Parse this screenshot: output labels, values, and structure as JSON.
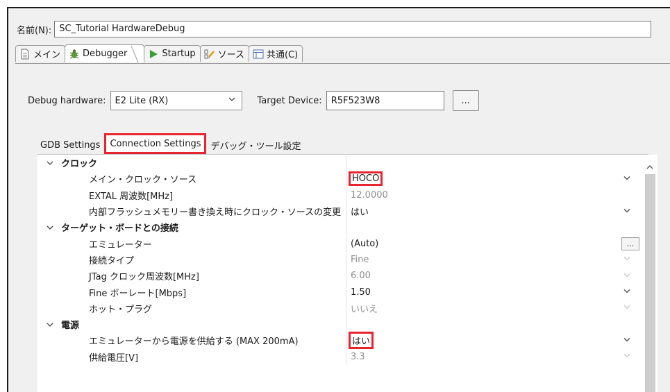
{
  "name_row": {
    "label": "名前(N):",
    "value": "SC_Tutorial HardwareDebug"
  },
  "main_tabs": [
    {
      "label": "メイン",
      "icon": "document-icon"
    },
    {
      "label": "Debugger",
      "icon": "bug-icon"
    },
    {
      "label": "Startup",
      "icon": "play-icon"
    },
    {
      "label": "ソース",
      "icon": "source-icon"
    },
    {
      "label": "共通(C)",
      "icon": "table-icon"
    }
  ],
  "debugger": {
    "hw_label": "Debug hardware:",
    "hw_value": "E2 Lite (RX)",
    "target_label": "Target Device:",
    "target_value": "R5F523W8",
    "browse_label": "..."
  },
  "sub_tabs": [
    {
      "label": "GDB Settings"
    },
    {
      "label": "Connection Settings"
    },
    {
      "label": "デバッグ・ツール設定"
    }
  ],
  "props": {
    "g1": "クロック",
    "r1": {
      "name": "メイン・クロック・ソース",
      "value": "HOCO"
    },
    "r2": {
      "name": "EXTAL 周波数[MHz]",
      "value": "12.0000"
    },
    "r3": {
      "name": "内部フラッシュメモリー書き換え時にクロック・ソースの変更",
      "value": "はい"
    },
    "g2": "ターゲット・ボードとの接続",
    "r4": {
      "name": "エミュレーター",
      "value": "(Auto)",
      "button": "..."
    },
    "r5": {
      "name": "接続タイプ",
      "value": "Fine"
    },
    "r6": {
      "name": "JTag クロック周波数[MHz]",
      "value": "6.00"
    },
    "r7": {
      "name": "Fine ボーレート[Mbps]",
      "value": "1.50"
    },
    "r8": {
      "name": "ホット・プラグ",
      "value": "いいえ"
    },
    "g3": "電源",
    "r9": {
      "name": "エミュレーターから電源を供給する (MAX 200mA)",
      "value": "はい"
    },
    "r10": {
      "name": "供給電圧[V]",
      "value": "3.3"
    }
  },
  "colors": {
    "highlight": "#e8242f",
    "window_bg": "#f0f0f0",
    "table_bg": "#ffffff",
    "dim_text": "#8f8f8f"
  }
}
